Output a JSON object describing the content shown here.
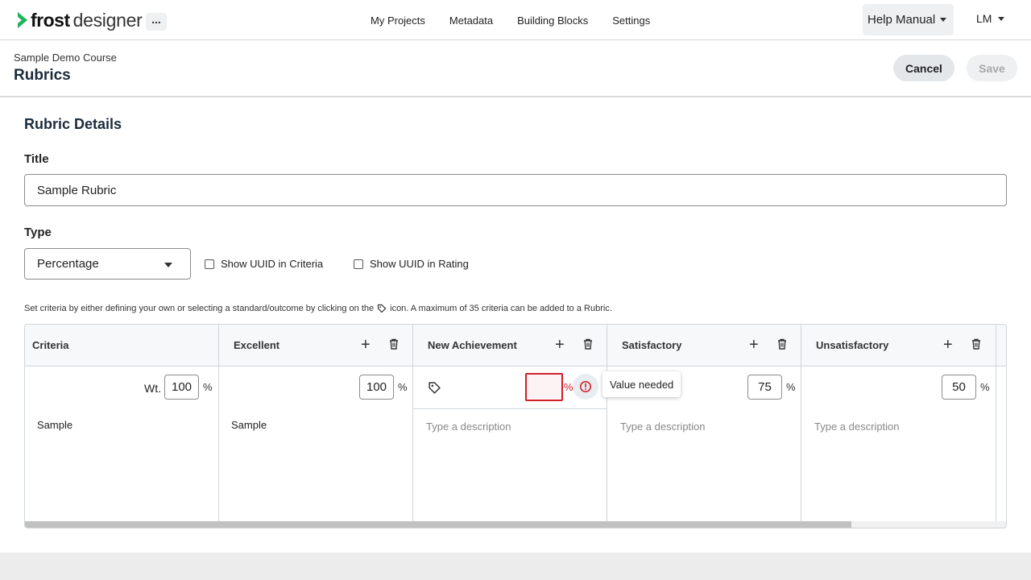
{
  "nav": {
    "logo_bold": "frost",
    "logo_regular": "designer",
    "more_label": "...",
    "links": [
      "My Projects",
      "Metadata",
      "Building Blocks",
      "Settings"
    ],
    "help_label": "Help Manual",
    "user_initials": "LM"
  },
  "header": {
    "course": "Sample Demo Course",
    "title": "Rubrics",
    "cancel_label": "Cancel",
    "save_label": "Save"
  },
  "details": {
    "section_title": "Rubric Details",
    "title_label": "Title",
    "title_value": "Sample Rubric",
    "type_label": "Type",
    "type_value": "Percentage",
    "show_uuid_criteria": "Show UUID in Criteria",
    "show_uuid_rating": "Show UUID in Rating",
    "hint_before": "Set criteria by either defining your own or selecting a standard/outcome by clicking on the",
    "hint_after": "icon. A maximum of 35 criteria can be added to a Rubric."
  },
  "rubric": {
    "criteria_header": "Criteria",
    "weight_label": "Wt.",
    "weight_value": "100",
    "pct_symbol": "%",
    "criteria_text": "Sample",
    "description_placeholder": "Type a description",
    "levels": [
      {
        "name": "Excellent",
        "value": "100",
        "description": "Sample"
      },
      {
        "name": "New Achievement",
        "value": "",
        "description": ""
      },
      {
        "name": "Satisfactory",
        "value": "75",
        "description": ""
      },
      {
        "name": "Unsatisfactory",
        "value": "50",
        "description": ""
      }
    ],
    "tooltip": "Value needed",
    "scroll_position": 0.84
  },
  "colors": {
    "accent_green": "#1fb35a",
    "error_red": "#d11f2a",
    "disabled_text": "#a8a8a8"
  }
}
